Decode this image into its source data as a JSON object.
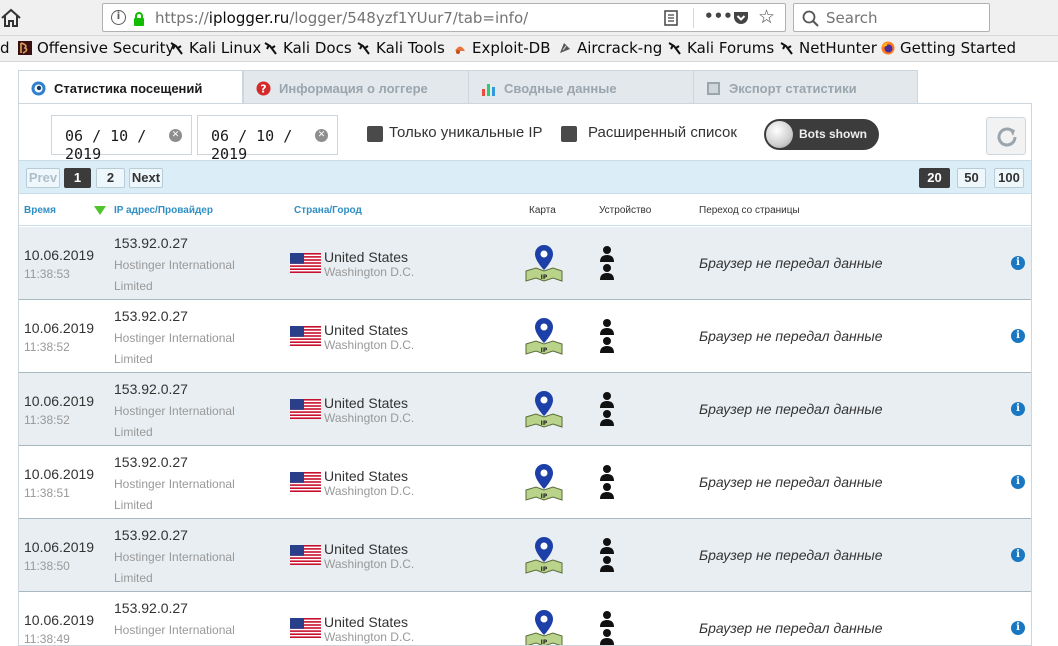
{
  "browser": {
    "url_domain": "iplogger.ru",
    "url_prefix": "https://",
    "url_path": "/logger/548yzf1YUur7/tab=info/",
    "search_placeholder": "Search",
    "bookmarks": [
      {
        "label": "Offensive Security",
        "icon": "offsec-icon"
      },
      {
        "label": "Kali Linux",
        "icon": "kali-dragon-icon"
      },
      {
        "label": "Kali Docs",
        "icon": "kali-dragon-icon"
      },
      {
        "label": "Kali Tools",
        "icon": "kali-dragon-icon"
      },
      {
        "label": "Exploit-DB",
        "icon": "exploitdb-icon"
      },
      {
        "label": "Aircrack-ng",
        "icon": "aircrack-icon"
      },
      {
        "label": "Kali Forums",
        "icon": "kali-dragon-icon"
      },
      {
        "label": "NetHunter",
        "icon": "kali-dragon-icon"
      },
      {
        "label": "Getting Started",
        "icon": "firefox-icon"
      }
    ],
    "bookmark_cut_char": "d"
  },
  "tabs": [
    {
      "label": "Статистика посещений",
      "icon": "eye-icon"
    },
    {
      "label": "Информация о логгере",
      "icon": "question-icon"
    },
    {
      "label": "Сводные данные",
      "icon": "bar-chart-icon"
    },
    {
      "label": "Экспорт статистики",
      "icon": "export-icon"
    }
  ],
  "filters": {
    "date_from": "06 / 10 / 2019",
    "date_to": "06 / 10 / 2019",
    "unique_ip_label": "Только уникальные IP",
    "extended_list_label": "Расширенный список",
    "bots_label": "Bots shown"
  },
  "pager": {
    "prev": "Prev",
    "pages": [
      "1",
      "2"
    ],
    "next": "Next",
    "page_sizes": [
      "20",
      "50",
      "100"
    ],
    "current_page": "1",
    "current_size": "20"
  },
  "columns": {
    "time": "Время",
    "ip": "IP адрес/Провайдер",
    "country": "Страна/Город",
    "map": "Карта",
    "device": "Устройство",
    "referrer": "Переход со страницы"
  },
  "rows": [
    {
      "date": "10.06.2019",
      "time": "11:38:53",
      "ip": "153.92.0.27",
      "provider": "Hostinger International Limited",
      "country": "United States",
      "city": "Washington D.C.",
      "referrer": "Браузер не передал данные"
    },
    {
      "date": "10.06.2019",
      "time": "11:38:52",
      "ip": "153.92.0.27",
      "provider": "Hostinger International Limited",
      "country": "United States",
      "city": "Washington D.C.",
      "referrer": "Браузер не передал данные"
    },
    {
      "date": "10.06.2019",
      "time": "11:38:52",
      "ip": "153.92.0.27",
      "provider": "Hostinger International Limited",
      "country": "United States",
      "city": "Washington D.C.",
      "referrer": "Браузер не передал данные"
    },
    {
      "date": "10.06.2019",
      "time": "11:38:51",
      "ip": "153.92.0.27",
      "provider": "Hostinger International Limited",
      "country": "United States",
      "city": "Washington D.C.",
      "referrer": "Браузер не передал данные"
    },
    {
      "date": "10.06.2019",
      "time": "11:38:50",
      "ip": "153.92.0.27",
      "provider": "Hostinger International Limited",
      "country": "United States",
      "city": "Washington D.C.",
      "referrer": "Браузер не передал данные"
    },
    {
      "date": "10.06.2019",
      "time": "11:38:49",
      "ip": "153.92.0.27",
      "provider": "Hostinger International Limited",
      "country": "United States",
      "city": "Washington D.C.",
      "referrer": "Браузер не передал данные"
    }
  ],
  "colors": {
    "accent": "#2f8fc4",
    "pager_bg": "#dbeef8",
    "row_alt": "#e8eef2",
    "info_blue": "#1a78c2",
    "map_pin": "#1d3fa8"
  }
}
